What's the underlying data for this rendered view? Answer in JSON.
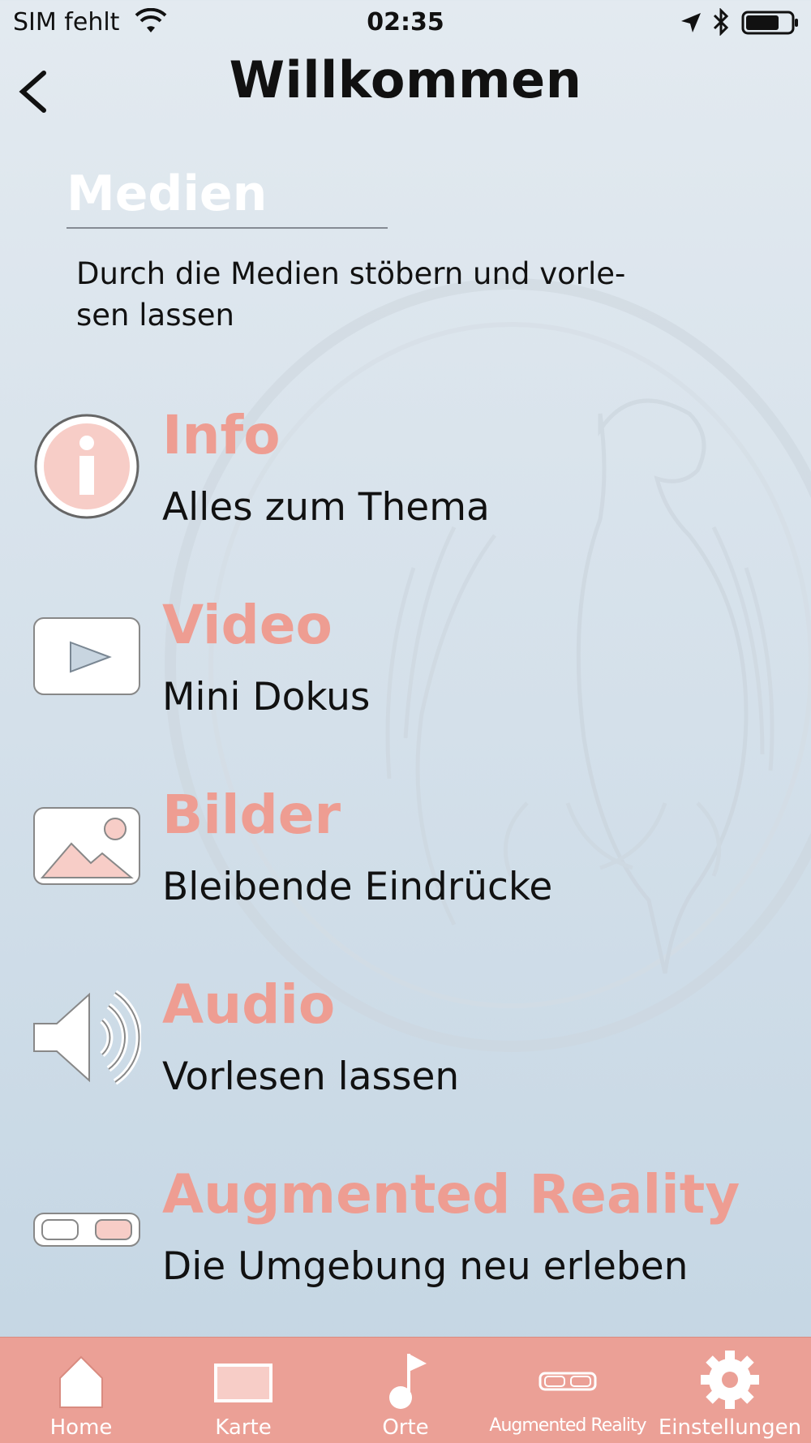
{
  "status_bar": {
    "carrier": "SIM fehlt",
    "time": "02:35"
  },
  "header": {
    "title": "Willkommen"
  },
  "section": {
    "title": "Medien",
    "subtitle_line1": "Durch die Medien stöbern und vorle-",
    "subtitle_line2": "sen lassen"
  },
  "media_items": [
    {
      "icon": "info-icon",
      "label": "Info",
      "description": "Alles zum Thema"
    },
    {
      "icon": "video-play-icon",
      "label": "Video",
      "description": "Mini Dokus"
    },
    {
      "icon": "image-icon",
      "label": "Bilder",
      "description": "Bleibende Eindrücke"
    },
    {
      "icon": "speaker-icon",
      "label": "Audio",
      "description": "Vorlesen lassen"
    },
    {
      "icon": "ar-glasses-icon",
      "label": "Augmented Reality",
      "description": "Die Umgebung neu erleben"
    }
  ],
  "tabs": [
    {
      "icon": "home-icon",
      "label": "Home"
    },
    {
      "icon": "map-icon",
      "label": "Karte"
    },
    {
      "icon": "flag-pin-icon",
      "label": "Orte"
    },
    {
      "icon": "ar-glasses-icon",
      "label": "Augmented Reality"
    },
    {
      "icon": "gear-icon",
      "label": "Einstellungen"
    }
  ],
  "colors": {
    "accent": "#ee9d92",
    "tabbar": "#eba096",
    "icon_fill": "#f7cdc7"
  }
}
